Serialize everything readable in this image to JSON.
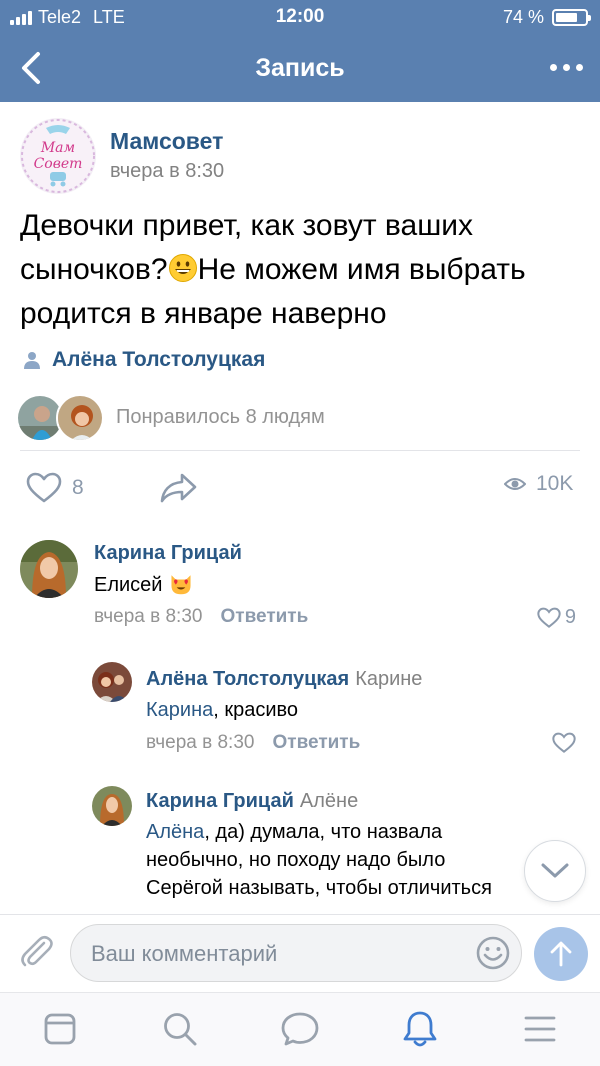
{
  "status_bar": {
    "carrier": "Tele2",
    "network": "LTE",
    "time": "12:00",
    "battery": "74 %",
    "battery_level": 0.74
  },
  "navbar": {
    "title": "Запись",
    "back_icon": "chevron-left-icon",
    "more_icon": "more-horizontal-icon"
  },
  "post": {
    "author": "Мамсовет",
    "time": "вчера в 8:30",
    "text_before_emoji": "Девочки привет, как зовут ваших сыночков?",
    "text_after_emoji": "Не можем имя выбрать родится в январе наверно",
    "emoji": "grinning-face",
    "signer": "Алёна Толстолуцкая",
    "logo_text_1": "Мам",
    "logo_text_2": "Совет",
    "liked_by": "Понравилось 8 людям",
    "likes_count": "8",
    "views": "10K"
  },
  "comments": [
    {
      "author": "Карина Грицай",
      "text": "Елисей",
      "emoji": "heart-eyes-cat",
      "time": "вчера в 8:30",
      "reply_label": "Ответить",
      "likes": "9"
    },
    {
      "author": "Алёна Толстолуцкая",
      "to": "Карине",
      "mention": "Карина",
      "text": ", красиво",
      "time": "вчера в 8:30",
      "reply_label": "Ответить"
    },
    {
      "author": "Карина Грицай",
      "to": "Алёне",
      "mention": "Алёна",
      "text": ", да) думала, что назвала необычно, но походу надо было Серёгой называть, чтобы отличиться"
    }
  ],
  "composer": {
    "placeholder": "Ваш комментарий"
  },
  "tabbar": {
    "items": [
      "feed-icon",
      "search-icon",
      "messages-icon",
      "notifications-icon",
      "menu-icon"
    ]
  },
  "colors": {
    "header": "#5a80b0",
    "link": "#2a5885",
    "secondary": "#828282",
    "active_tab": "#3f7ccf"
  }
}
